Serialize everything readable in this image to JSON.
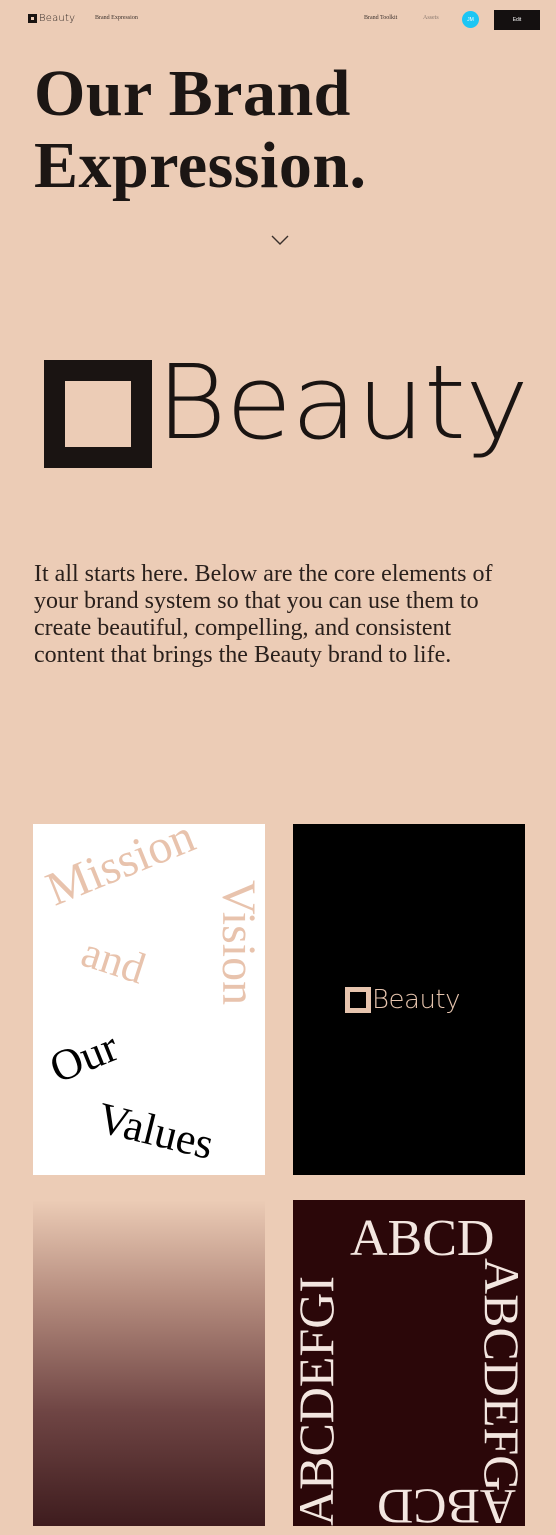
{
  "nav": {
    "logo_text": "Beauty",
    "brand_expression_link": "Brand Expression",
    "brand_toolkit_link": "Brand Toolkit",
    "assets_link": "Assets",
    "avatar_initials": "JM",
    "edit_button": "Edit"
  },
  "hero": {
    "title_line1": "Our Brand",
    "title_line2": "Expression."
  },
  "brand_logo": {
    "wordmark": "Beauty"
  },
  "intro_text": "It all starts here. Below are the core elements of your brand system so that you can use them to create beautiful, compelling, and consistent content that brings the Beauty brand to life.",
  "cards": {
    "mission": {
      "word_mission": "Mission",
      "word_and": "and",
      "word_vision": "Vision",
      "word_our": "Our",
      "word_values": "Values"
    },
    "logo": {
      "wordmark": "Beauty"
    },
    "typography": {
      "top": "ABCD",
      "left": "ABCDEFGI",
      "right": "ABCDEFG",
      "bottom": "ABCD"
    }
  },
  "colors": {
    "background": "#ecccb6",
    "ink": "#1a1412",
    "accent_avatar": "#1cc6f4",
    "dark_maroon": "#2b0709"
  }
}
